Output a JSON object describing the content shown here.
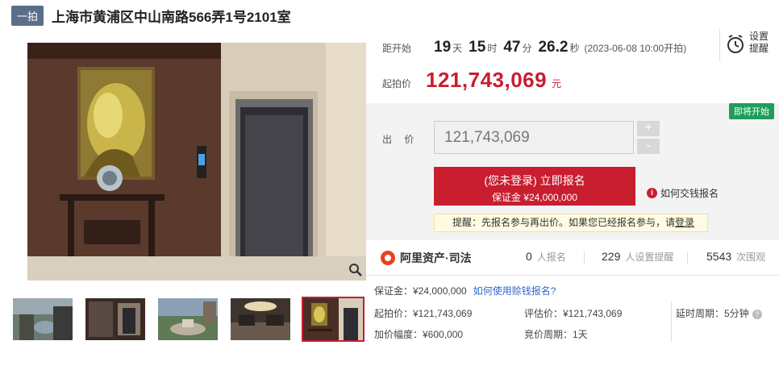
{
  "header": {
    "badge": "一拍",
    "title": "上海市黄浦区中山南路566弄1号2101室"
  },
  "countdown": {
    "label": "距开始",
    "days": "19",
    "days_unit": "天",
    "hours": "15",
    "hours_unit": "时",
    "minutes": "47",
    "minutes_unit": "分",
    "seconds": "26.2",
    "seconds_unit": "秒",
    "start_time": "(2023-06-08 10:00开拍)"
  },
  "start_price": {
    "label": "起拍价",
    "value": "121,743,069",
    "unit": "元"
  },
  "remind": {
    "label": "设置提醒",
    "icon": "alarm-clock-icon"
  },
  "bid": {
    "status_tag": "即将开始",
    "label": "出 价",
    "value": "121,743,069",
    "plus": "+",
    "minus": "-",
    "signup_main": "(您未登录) 立即报名",
    "signup_sub": "保证金 ¥24,000,000",
    "howto": "如何交钱报名",
    "tip_prefix": "提醒：先报名参与再出价。如果您已经报名参与，请",
    "tip_link": "登录"
  },
  "stats": {
    "brand": "阿里资产·司法",
    "signup_count": "0",
    "signup_unit": "人报名",
    "remind_count": "229",
    "remind_unit": "人设置提醒",
    "view_count": "5543",
    "view_unit": "次围观"
  },
  "details": {
    "deposit": "保证金：¥24,000,000",
    "deposit_link": "如何使用赊钱报名?",
    "start_price": "起拍价：¥121,743,069",
    "appraisal": "评估价：¥121,743,069",
    "delay": "延时周期：5分钟",
    "increment": "加价幅度：¥600,000",
    "bid_cycle": "竞价周期：1天"
  },
  "colors": {
    "accent": "#c81e30",
    "green": "#1d9e5a",
    "link": "#3366cc"
  }
}
